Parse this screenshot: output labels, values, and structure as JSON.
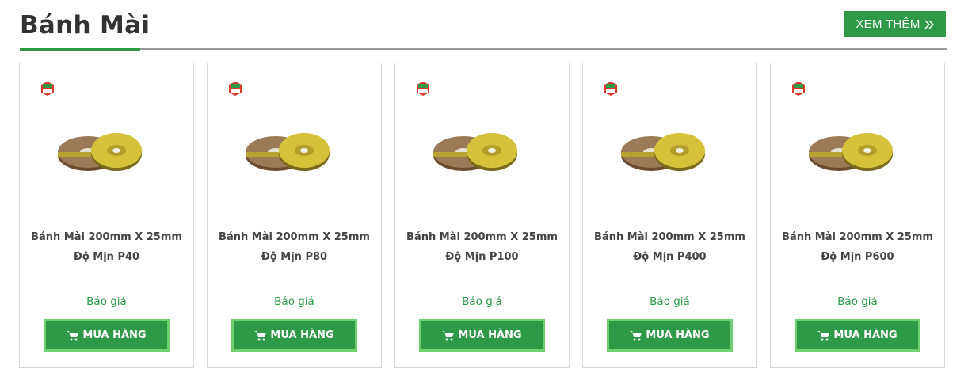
{
  "section": {
    "title": "Bánh Mài",
    "more_label": "XEM THÊM"
  },
  "products": [
    {
      "name": "Bánh Mài 200mm X 25mm Độ Mịn P40",
      "price": "Báo giá",
      "buy_label": "MUA HÀNG"
    },
    {
      "name": "Bánh Mài 200mm X 25mm Độ Mịn P80",
      "price": "Báo giá",
      "buy_label": "MUA HÀNG"
    },
    {
      "name": "Bánh Mài 200mm X 25mm Độ Mịn P100",
      "price": "Báo giá",
      "buy_label": "MUA HÀNG"
    },
    {
      "name": "Bánh Mài 200mm X 25mm Độ Mịn P400",
      "price": "Báo giá",
      "buy_label": "MUA HÀNG"
    },
    {
      "name": "Bánh Mài 200mm X 25mm Độ Mịn P600",
      "price": "Báo giá",
      "buy_label": "MUA HÀNG"
    }
  ],
  "icons": {
    "more": "double-chevron-right-icon",
    "buy": "cart-icon",
    "brand": "brand-logo-icon"
  },
  "colors": {
    "accent": "#2e9a48",
    "button_border": "#6ed06f",
    "title": "#333333",
    "text": "#444444"
  }
}
